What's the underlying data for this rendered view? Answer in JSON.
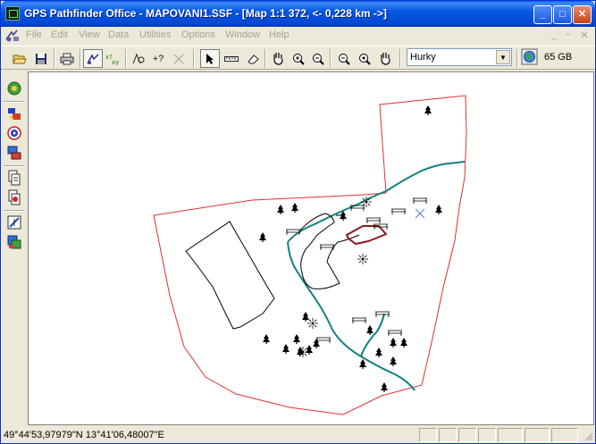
{
  "window": {
    "title": "GPS Pathfinder Office - MAPOVANI1.SSF - [Map 1:1 372, <- 0,228 km ->]"
  },
  "menu": {
    "items": [
      "File",
      "Edit",
      "View",
      "Data",
      "Utilities",
      "Options",
      "Window",
      "Help"
    ]
  },
  "toolbar": {
    "buttons": [
      "open-icon",
      "save-icon",
      "print-icon",
      "layers-icon",
      "feature-properties-icon",
      "search-icon",
      "add-point-icon",
      "remove-icon",
      "select-arrow-icon",
      "measure-icon",
      "eraser-icon",
      "pan-hand-icon",
      "zoom-in-icon",
      "zoom-out-icon",
      "zoom-previous-icon",
      "zoom-extent-icon",
      "pan-hand-alt-icon",
      "globe-icon"
    ],
    "layer_selected": "Hurky",
    "disk_space": "65 GB"
  },
  "left_toolbar": {
    "buttons": [
      "project-icon",
      "data-transfer-icon",
      "target-icon",
      "import-icon",
      "export-icon",
      "convert-icon",
      "edit-icon",
      "report-icon"
    ]
  },
  "map": {
    "boundary_color": "#e03030",
    "stream_color": "#128080",
    "path_color": "#000000",
    "fence_color": "#8b1a1a",
    "crossing_marker_color": "#5b8de0"
  },
  "status": {
    "coordinates": "49°44'53,97979\"N  13°41'06,48007\"E"
  }
}
